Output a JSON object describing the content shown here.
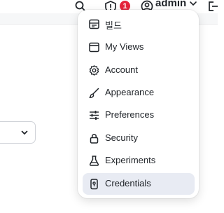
{
  "header": {
    "notification_count": "1",
    "user_name": "admin"
  },
  "user_menu": {
    "items": [
      {
        "label": "빌드",
        "icon": "build-icon"
      },
      {
        "label": "My Views",
        "icon": "window-icon"
      },
      {
        "label": "Account",
        "icon": "gear-icon"
      },
      {
        "label": "Appearance",
        "icon": "brush-icon"
      },
      {
        "label": "Preferences",
        "icon": "sliders-icon"
      },
      {
        "label": "Security",
        "icon": "lock-icon"
      },
      {
        "label": "Experiments",
        "icon": "flask-icon"
      },
      {
        "label": "Credentials",
        "icon": "credentials-icon"
      }
    ],
    "active_item": "Credentials"
  },
  "colors": {
    "badge": "#e5253b",
    "active_item_bg": "#e8ebf3"
  }
}
